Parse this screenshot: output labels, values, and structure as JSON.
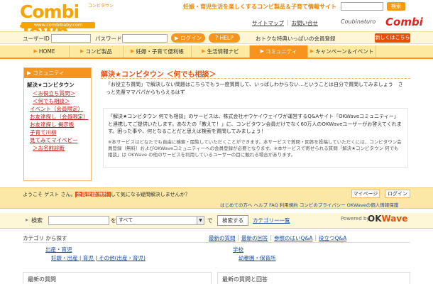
{
  "header": {
    "logo_text": "Combi Town",
    "logo_kana": "コンビタウン",
    "logo_url": "www.combibaby.com",
    "tagline": "妊娠・育児生活を楽しくするコンビ製品＆子育て情報サイト",
    "search_button": "検索",
    "links": [
      "サイトマップ",
      "お問い合せ"
    ],
    "partner_logo": "Coubinaturo",
    "brand_logo": "Combi"
  },
  "login": {
    "user_id_label": "ユーザーID",
    "password_label": "パスワード",
    "login_button": "ログイン",
    "help_button": "HELP",
    "promo_text": "おトクな特典いっぱいの会員登録",
    "register_button": "新しくはこちら"
  },
  "nav": {
    "tabs": [
      {
        "label": "HOME",
        "active": false
      },
      {
        "label": "コンビ製品",
        "active": false
      },
      {
        "label": "妊娠・子育て便利帳",
        "active": false
      },
      {
        "label": "生活情報ナビ",
        "active": false
      },
      {
        "label": "コミュニティ",
        "active": true
      },
      {
        "label": "キャンペーン＆イベント",
        "active": false
      }
    ]
  },
  "sidebar": {
    "title": "コミュニティ",
    "subtitle": "解決★コンビタウン",
    "items": [
      {
        "label": "＜お役立ち質問＞",
        "indent": true
      },
      {
        "label": "＜何でも相談＞",
        "indent": true
      },
      {
        "label": "イベント（会員限定）",
        "indent": false
      },
      {
        "label": "お友達探し（会員限定）",
        "indent": false
      },
      {
        "label": "お友達探し 掲示板",
        "indent": false
      },
      {
        "label": "子育て川柳",
        "indent": false
      },
      {
        "label": "見てみてマイベビー",
        "indent": false
      },
      {
        "label": "＞お名前診断",
        "indent": true
      }
    ]
  },
  "main": {
    "title": "解決★コンビタウン ＜何でも相談＞",
    "intro": "「お役立ち質問」で解決しない問題はこちらでもう一度質問して、いっぱしわからない…ということは自分で質問してみましょう　さっと先輩ママパパからもらえるはず",
    "description": "「解決★コンビタウン 何でも相談」のサービスは、株式会社オウケイウェイヴが運営するQ&Aサイト「OKWaveコミュニティー」と連携してご提供いたします。あなたの「教えて！」に、コンビタウン会員だけでなく60万人のOKWaveユーザーがお答えてくれます。困った事や、何となることだと思えば検索を質問してみましょう！",
    "note": "※本サービスはどなたでも自由に検索・閲覧していただくことができます。本サービスで質問・回答を投稿していただくには、コンビタウン会員登録（無料）およびOKWaveコミュニティーへの会員登録が必要となります。※本サービスで寄せられる質問「解決★コンビタウン 何でも相談」は OKWave の他のサービスを利用しているユーザーの目に触れる場合があります。"
  },
  "welcome": {
    "prefix": "ようこそ ゲスト さん。",
    "highlight": "会員登録(無料)",
    "suffix": "して気になる疑問解決しませんか？",
    "mypage_button": "マイページ",
    "logout_button": "ログイン",
    "sub_link_text": "はじめての方へ  ヘルプ  FAQ  利用規約  コンビのプライバシー  OKWaveの個人情報保護"
  },
  "search": {
    "label": "検索",
    "wo": "を",
    "select_value": "すべて",
    "de": "で",
    "button": "検索する",
    "category_link": "カテゴリー一覧",
    "powered_by": "Powered by",
    "okwave_ok": "OK",
    "okwave_wave": "Wave"
  },
  "categories": {
    "title": "カテゴリ から探す",
    "links": [
      "最新の質問",
      "最新の回答",
      "参照のはいQ&A",
      "役立つQ&A"
    ],
    "col1_title": "出産・育児",
    "col1_sub": "妊娠・出産 | 育児 | その他(出産・育児)",
    "col2_title": "学校",
    "col2_sub": "幼稚園・保育所"
  },
  "bottom": {
    "left_title": "最新の質問",
    "right_title": "最新の質問と回答"
  }
}
